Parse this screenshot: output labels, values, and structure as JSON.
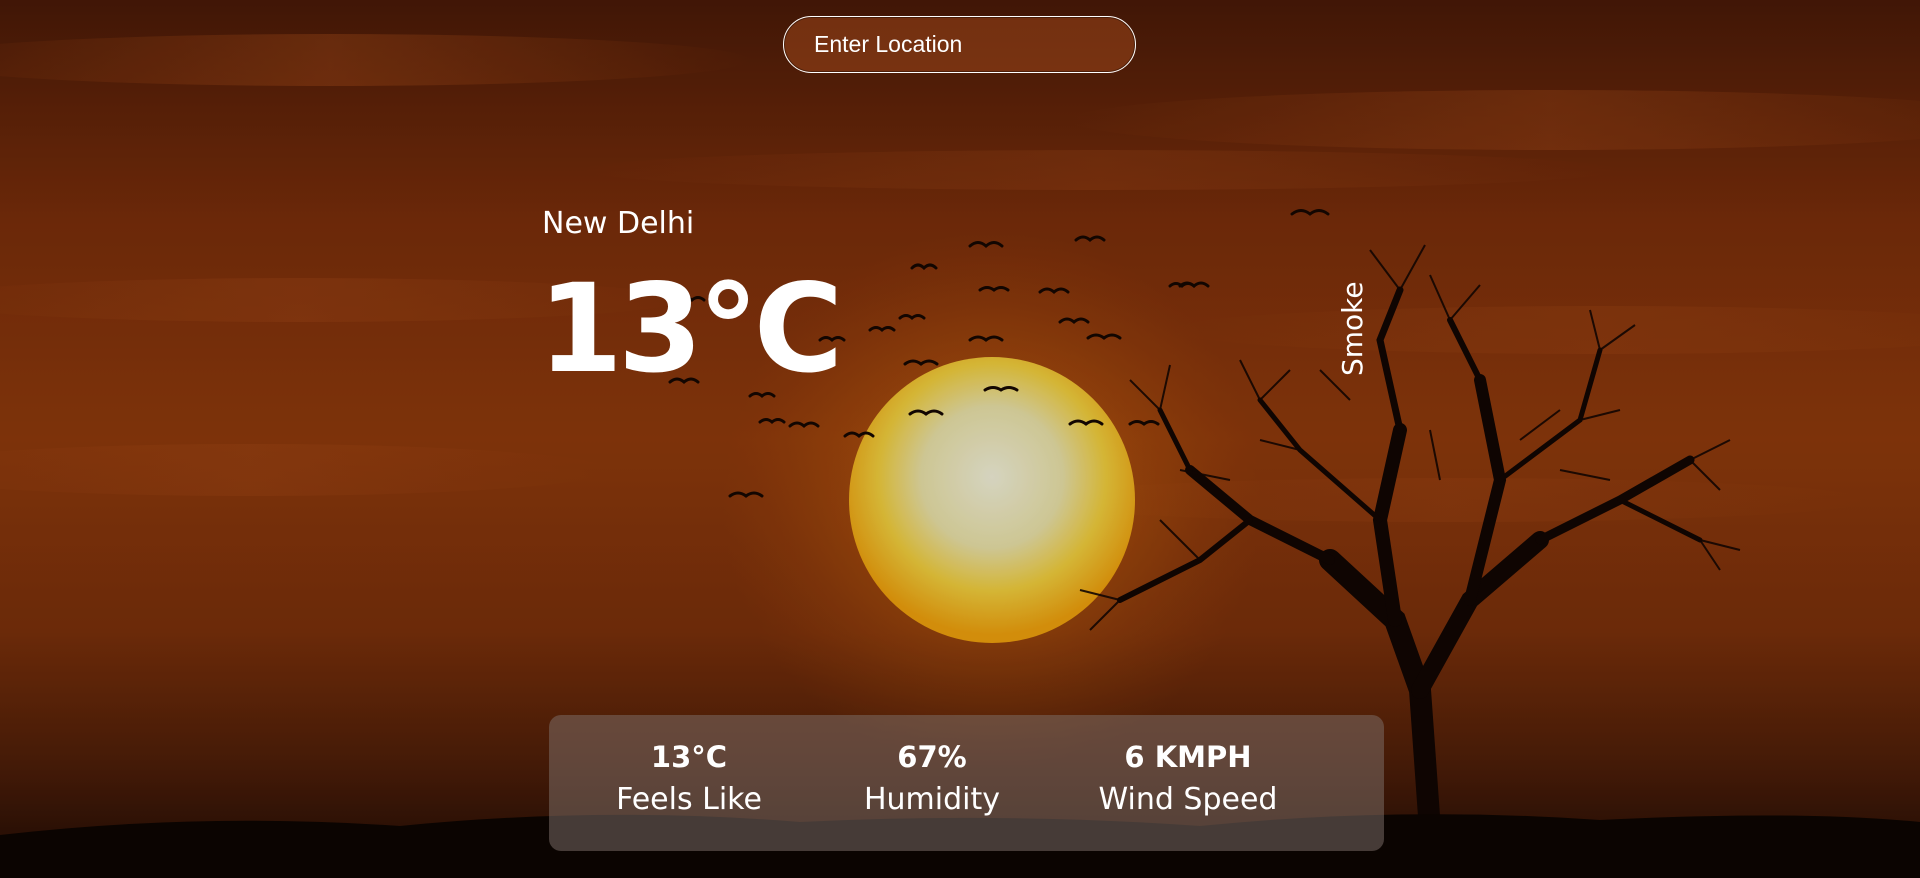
{
  "search": {
    "placeholder": "Enter Location",
    "value": ""
  },
  "weather": {
    "location": "New Delhi",
    "temperature": "13°C",
    "condition": "Smoke"
  },
  "stats": {
    "feels_like": {
      "value": "13°C",
      "label": "Feels Like"
    },
    "humidity": {
      "value": "67%",
      "label": "Humidity"
    },
    "wind_speed": {
      "value": "6 KMPH",
      "label": "Wind Speed"
    }
  },
  "theme": {
    "text_color": "#ffffff",
    "panel_color": "#7d706a",
    "sky_top": "#5a1f08",
    "sun_core": "#f2f0d2",
    "sun_glow": "#f5a20f"
  }
}
